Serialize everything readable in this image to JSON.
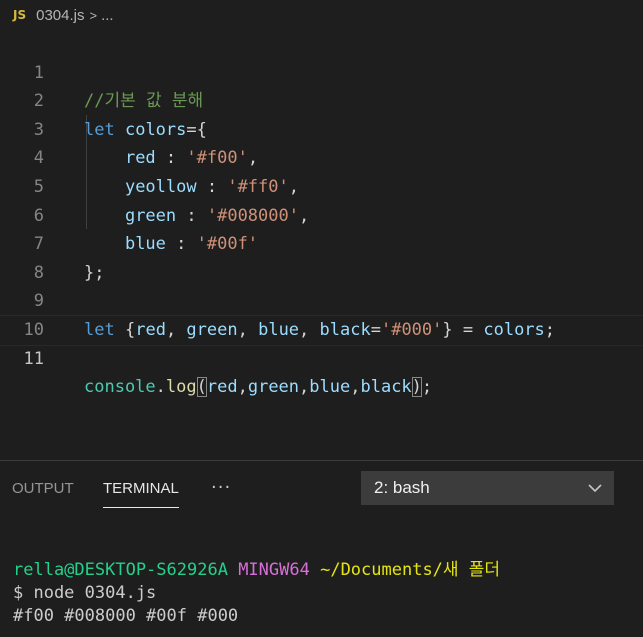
{
  "breadcrumb": {
    "file_icon": "JS",
    "file_name": "0304.js",
    "chevron": ">",
    "more": "..."
  },
  "editor": {
    "lines": [
      {
        "num": "1"
      },
      {
        "num": "2"
      },
      {
        "num": "3"
      },
      {
        "num": "4"
      },
      {
        "num": "5"
      },
      {
        "num": "6"
      },
      {
        "num": "7"
      },
      {
        "num": "8"
      },
      {
        "num": "9"
      },
      {
        "num": "10"
      },
      {
        "num": "11"
      }
    ],
    "tokens": {
      "comment": "//기본 값 분해",
      "let": "let",
      "colors": "colors",
      "eq": "=",
      "lbrace": "{",
      "rbrace": "}",
      "semi": ";",
      "rbrace_semi": "};",
      "colon": " : ",
      "comma": ",",
      "comma_sp": ", ",
      "red": "red",
      "yeollow": "yeollow",
      "green": "green",
      "blue": "blue",
      "black": "black",
      "s_f00": "'#f00'",
      "s_ff0": "'#ff0'",
      "s_008000": "'#008000'",
      "s_00f": "'#00f'",
      "s_000": "'#000'",
      "destruct_eq": " = ",
      "console": "console",
      "dot": ".",
      "log": "log",
      "lparen": "(",
      "rparen": ")"
    }
  },
  "panel": {
    "tabs": [
      "OUTPUT",
      "TERMINAL"
    ],
    "active_tab": "TERMINAL",
    "more": "···",
    "terminal_select": "2: bash",
    "terminal": {
      "user": "rella@DESKTOP-S62926A",
      "env": "MINGW64",
      "path": "~/Documents/새 폴더",
      "command": "$ node 0304.js",
      "output": "#f00 #008000 #00f #000"
    }
  },
  "colors": {
    "background": "#1e1e1e",
    "keyword": "#569cd6",
    "variable": "#9cdcfe",
    "string": "#ce9178",
    "comment": "#6a9955",
    "function": "#dcdcaa",
    "class": "#4ec9b0",
    "terminal_green": "#23d18b",
    "terminal_magenta": "#d670d6",
    "terminal_yellow": "#e5e510"
  },
  "icons": {
    "file": "javascript-file-icon",
    "breadcrumb_separator": "chevron-right-icon",
    "panel_more": "more-horizontal-icon",
    "select": "chevron-down-icon"
  }
}
